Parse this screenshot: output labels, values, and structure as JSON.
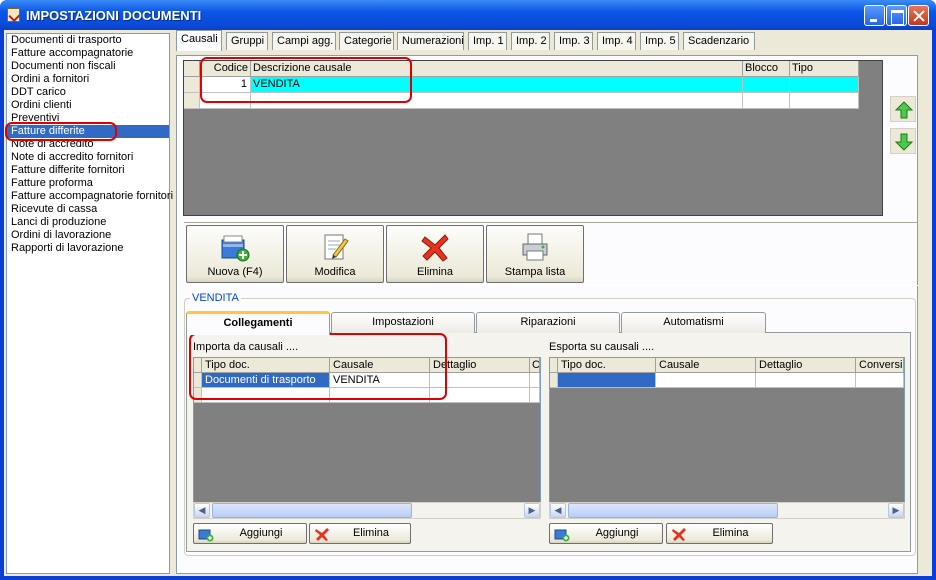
{
  "window": {
    "title": "IMPOSTAZIONI DOCUMENTI"
  },
  "doc_types": [
    "Documenti di trasporto",
    "Fatture accompagnatorie",
    "Documenti non fiscali",
    "Ordini a fornitori",
    "DDT carico",
    "Ordini clienti",
    "Preventivi",
    "Fatture differite",
    "Note di accredito",
    "Note di accredito fornitori",
    "Fatture differite fornitori",
    "Fatture proforma",
    "Fatture accompagnatorie fornitori",
    "Ricevute di cassa",
    "Lanci di produzione",
    "Ordini di lavorazione",
    "Rapporti di lavorazione"
  ],
  "selected_doc_type": "Fatture differite",
  "top_tabs": [
    "Causali",
    "Gruppi",
    "Campi agg.",
    "Categorie",
    "Numerazioni",
    "Imp. 1",
    "Imp. 2",
    "Imp. 3",
    "Imp. 4",
    "Imp. 5",
    "Scadenzario"
  ],
  "active_top_tab": "Causali",
  "causali_grid": {
    "columns": [
      "Codice",
      "Descrizione causale",
      "Blocco",
      "Tipo"
    ],
    "rows": [
      {
        "codice": "1",
        "descrizione": "VENDITA",
        "blocco": "",
        "tipo": ""
      }
    ]
  },
  "toolbar": {
    "new_label": "Nuova (F4)",
    "edit_label": "Modifica",
    "delete_label": "Elimina",
    "print_label": "Stampa lista"
  },
  "detail_group_title": "VENDITA",
  "detail_tabs": [
    "Collegamenti",
    "Impostazioni",
    "Riparazioni",
    "Automatismi"
  ],
  "active_detail_tab": "Collegamenti",
  "import_panel": {
    "label": "Importa da causali ....",
    "columns": [
      "Tipo doc.",
      "Causale",
      "Dettaglio",
      "C"
    ],
    "rows": [
      {
        "tipo_doc": "Documenti di trasporto",
        "causale": "VENDITA",
        "dettaglio": ""
      }
    ],
    "add_label": "Aggiungi",
    "delete_label": "Elimina"
  },
  "export_panel": {
    "label": "Esporta su causali ....",
    "columns": [
      "Tipo doc.",
      "Causale",
      "Dettaglio",
      "Conversi"
    ],
    "add_label": "Aggiungi",
    "delete_label": "Elimina"
  },
  "colors": {
    "selection": "#316ac5",
    "row_highlight": "#00ffff",
    "annotation": "#e00000"
  }
}
